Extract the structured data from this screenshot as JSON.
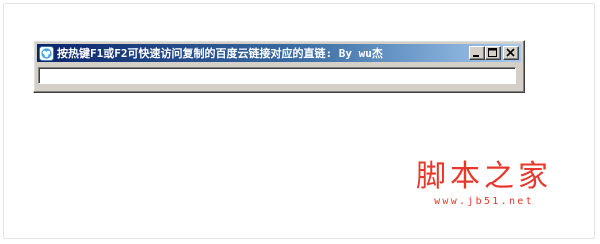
{
  "window": {
    "title": "按热键F1或F2可快速访问复制的百度云链接对应的直链: By wu杰",
    "url_value": "",
    "buttons": {
      "minimize": "minimize",
      "maximize": "maximize",
      "close": "close"
    }
  },
  "watermark": {
    "title": "脚本之家",
    "url": "www.jb51.net"
  },
  "colors": {
    "titlebar_start": "#0a246a",
    "titlebar_end": "#a6caf0",
    "window_face": "#d4d0c8",
    "watermark": "#e8372c"
  },
  "icons": {
    "app": "app-icon",
    "minimize": "minimize-icon",
    "maximize": "maximize-icon",
    "close": "close-icon"
  }
}
